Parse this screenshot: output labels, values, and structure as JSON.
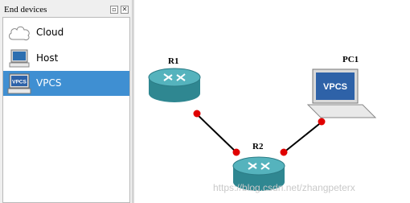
{
  "panel": {
    "title": "End devices",
    "items": [
      {
        "label": "Cloud",
        "icon": "cloud-icon"
      },
      {
        "label": "Host",
        "icon": "host-icon"
      },
      {
        "label": "VPCS",
        "icon": "vpcs-icon",
        "selected": true,
        "icon_text": "VPCS"
      }
    ]
  },
  "topology": {
    "nodes": [
      {
        "name": "R1",
        "type": "router"
      },
      {
        "name": "R2",
        "type": "router"
      },
      {
        "name": "PC1",
        "type": "vpcs",
        "screen_text": "VPCS"
      }
    ],
    "links": [
      {
        "from": "R1",
        "to": "R2",
        "status": "down"
      },
      {
        "from": "R2",
        "to": "PC1",
        "status": "down"
      }
    ]
  },
  "colors": {
    "selection": "#3f8fd2",
    "link_dot": "#e00000",
    "router_body": "#3d9aa5"
  },
  "watermark": "https://blog.csdn.net/zhangpeterx"
}
